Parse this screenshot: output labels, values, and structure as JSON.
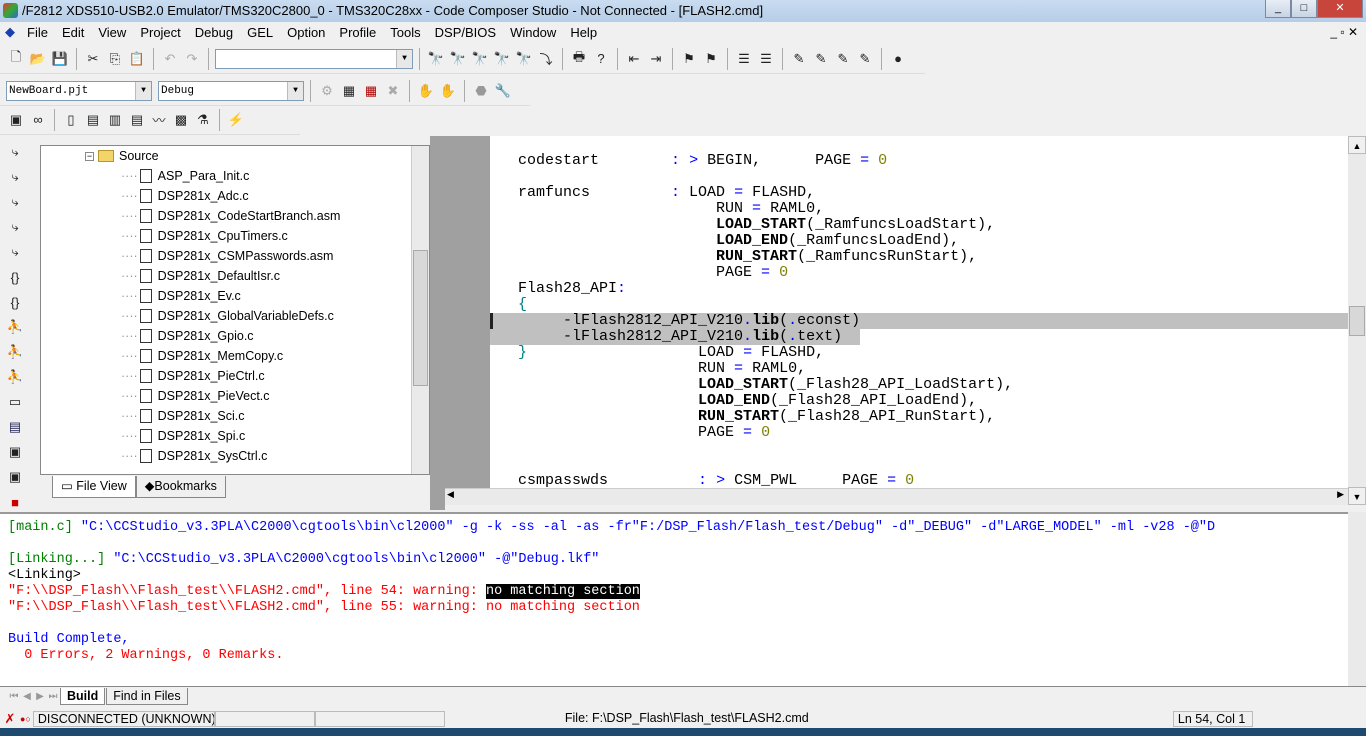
{
  "window": {
    "title": "/F2812 XDS510-USB2.0 Emulator/TMS320C2800_0 - TMS320C28xx - Code Composer Studio - Not Connected - [FLASH2.cmd]"
  },
  "menu": [
    "File",
    "Edit",
    "View",
    "Project",
    "Debug",
    "GEL",
    "Option",
    "Profile",
    "Tools",
    "DSP/BIOS",
    "Window",
    "Help"
  ],
  "toolbar": {
    "find_value": "",
    "project_select": "NewBoard.pjt",
    "config_select": "Debug"
  },
  "project_tree": {
    "folder": "Source",
    "files": [
      "ASP_Para_Init.c",
      "DSP281x_Adc.c",
      "DSP281x_CodeStartBranch.asm",
      "DSP281x_CpuTimers.c",
      "DSP281x_CSMPasswords.asm",
      "DSP281x_DefaultIsr.c",
      "DSP281x_Ev.c",
      "DSP281x_GlobalVariableDefs.c",
      "DSP281x_Gpio.c",
      "DSP281x_MemCopy.c",
      "DSP281x_PieCtrl.c",
      "DSP281x_PieVect.c",
      "DSP281x_Sci.c",
      "DSP281x_Spi.c",
      "DSP281x_SysCtrl.c"
    ],
    "tabs": [
      "File View",
      "Bookmarks"
    ]
  },
  "editor": {
    "lines": [
      [
        [
          "codestart        ",
          "p"
        ],
        [
          ":",
          "o"
        ],
        [
          " ",
          "p"
        ],
        [
          ">",
          "o"
        ],
        [
          " BEGIN,      PAGE ",
          "p"
        ],
        [
          "=",
          "o"
        ],
        [
          " ",
          "p"
        ],
        [
          "0",
          "n"
        ]
      ],
      [],
      [
        [
          "ramfuncs         ",
          "p"
        ],
        [
          ":",
          "o"
        ],
        [
          " LOAD ",
          "p"
        ],
        [
          "=",
          "o"
        ],
        [
          " FLASHD,",
          "p"
        ]
      ],
      [
        [
          "                      RUN ",
          "p"
        ],
        [
          "=",
          "o"
        ],
        [
          " RAML0,",
          "p"
        ]
      ],
      [
        [
          "                      ",
          "p"
        ],
        [
          "LOAD_START",
          "b"
        ],
        [
          "(_RamfuncsLoadStart),",
          "p"
        ]
      ],
      [
        [
          "                      ",
          "p"
        ],
        [
          "LOAD_END",
          "b"
        ],
        [
          "(_RamfuncsLoadEnd),",
          "p"
        ]
      ],
      [
        [
          "                      ",
          "p"
        ],
        [
          "RUN_START",
          "b"
        ],
        [
          "(_RamfuncsRunStart),",
          "p"
        ]
      ],
      [
        [
          "                      PAGE ",
          "p"
        ],
        [
          "=",
          "o"
        ],
        [
          " ",
          "p"
        ],
        [
          "0",
          "n"
        ]
      ],
      [
        [
          "Flash28_API",
          "p"
        ],
        [
          ":",
          "o"
        ]
      ],
      [
        [
          "{",
          "c"
        ]
      ],
      [
        [
          "     -lFlash2812_API_V210",
          "p"
        ],
        [
          ".",
          "o"
        ],
        [
          "lib",
          "b"
        ],
        [
          "(",
          "p"
        ],
        [
          ".",
          "o"
        ],
        [
          "econst)",
          "p"
        ]
      ],
      [
        [
          "     -lFlash2812_API_V210",
          "p"
        ],
        [
          ".",
          "o"
        ],
        [
          "lib",
          "b"
        ],
        [
          "(",
          "p"
        ],
        [
          ".",
          "o"
        ],
        [
          "text)",
          "p"
        ]
      ],
      [
        [
          "}",
          "c"
        ],
        [
          "                   LOAD ",
          "p"
        ],
        [
          "=",
          "o"
        ],
        [
          " FLASHD,",
          "p"
        ]
      ],
      [
        [
          "                    RUN ",
          "p"
        ],
        [
          "=",
          "o"
        ],
        [
          " RAML0,",
          "p"
        ]
      ],
      [
        [
          "                    ",
          "p"
        ],
        [
          "LOAD_START",
          "b"
        ],
        [
          "(_Flash28_API_LoadStart),",
          "p"
        ]
      ],
      [
        [
          "                    ",
          "p"
        ],
        [
          "LOAD_END",
          "b"
        ],
        [
          "(_Flash28_API_LoadEnd),",
          "p"
        ]
      ],
      [
        [
          "                    ",
          "p"
        ],
        [
          "RUN_START",
          "b"
        ],
        [
          "(_Flash28_API_RunStart),",
          "p"
        ]
      ],
      [
        [
          "                    PAGE ",
          "p"
        ],
        [
          "=",
          "o"
        ],
        [
          " ",
          "p"
        ],
        [
          "0",
          "n"
        ]
      ],
      [],
      [],
      [
        [
          "csmpasswds          ",
          "p"
        ],
        [
          ":",
          "o"
        ],
        [
          " ",
          "p"
        ],
        [
          ">",
          "o"
        ],
        [
          " CSM_PWL     PAGE ",
          "p"
        ],
        [
          "=",
          "o"
        ],
        [
          " ",
          "p"
        ],
        [
          "0",
          "n"
        ]
      ]
    ]
  },
  "output": {
    "lines": [
      [
        [
          "[main.c] ",
          "g"
        ],
        [
          "\"C:\\CCStudio_v3.3PLA\\C2000\\cgtools\\bin\\cl2000\" -g -k -ss -al -as -fr\"F:/DSP_Flash/Flash_test/Debug\" -d\"_DEBUG\" -d\"LARGE_MODEL\" -ml -v28 -@\"D",
          "b"
        ]
      ],
      [],
      [
        [
          "[Linking...] ",
          "g"
        ],
        [
          "\"C:\\CCStudio_v3.3PLA\\C2000\\cgtools\\bin\\cl2000\" -@\"Debug.lkf\"",
          "b"
        ]
      ],
      [
        [
          "<Linking>",
          "k"
        ]
      ],
      [
        [
          "\"F:\\\\DSP_Flash\\\\Flash_test\\\\FLASH2.cmd\", line 54: warning: ",
          "r"
        ],
        [
          "no matching section",
          "sel"
        ]
      ],
      [
        [
          "\"F:\\\\DSP_Flash\\\\Flash_test\\\\FLASH2.cmd\", line 55: warning: no matching section",
          "r"
        ]
      ],
      [],
      [
        [
          "Build Complete,",
          "b"
        ]
      ],
      [
        [
          "  0 Errors, 2 Warnings, 0 Remarks.",
          "r"
        ]
      ]
    ],
    "tabs": [
      "Build",
      "Find in Files"
    ]
  },
  "status": {
    "connection": "DISCONNECTED (UNKNOWN)",
    "file": "File: F:\\DSP_Flash\\Flash_test\\FLASH2.cmd",
    "position": "Ln 54, Col 1"
  }
}
